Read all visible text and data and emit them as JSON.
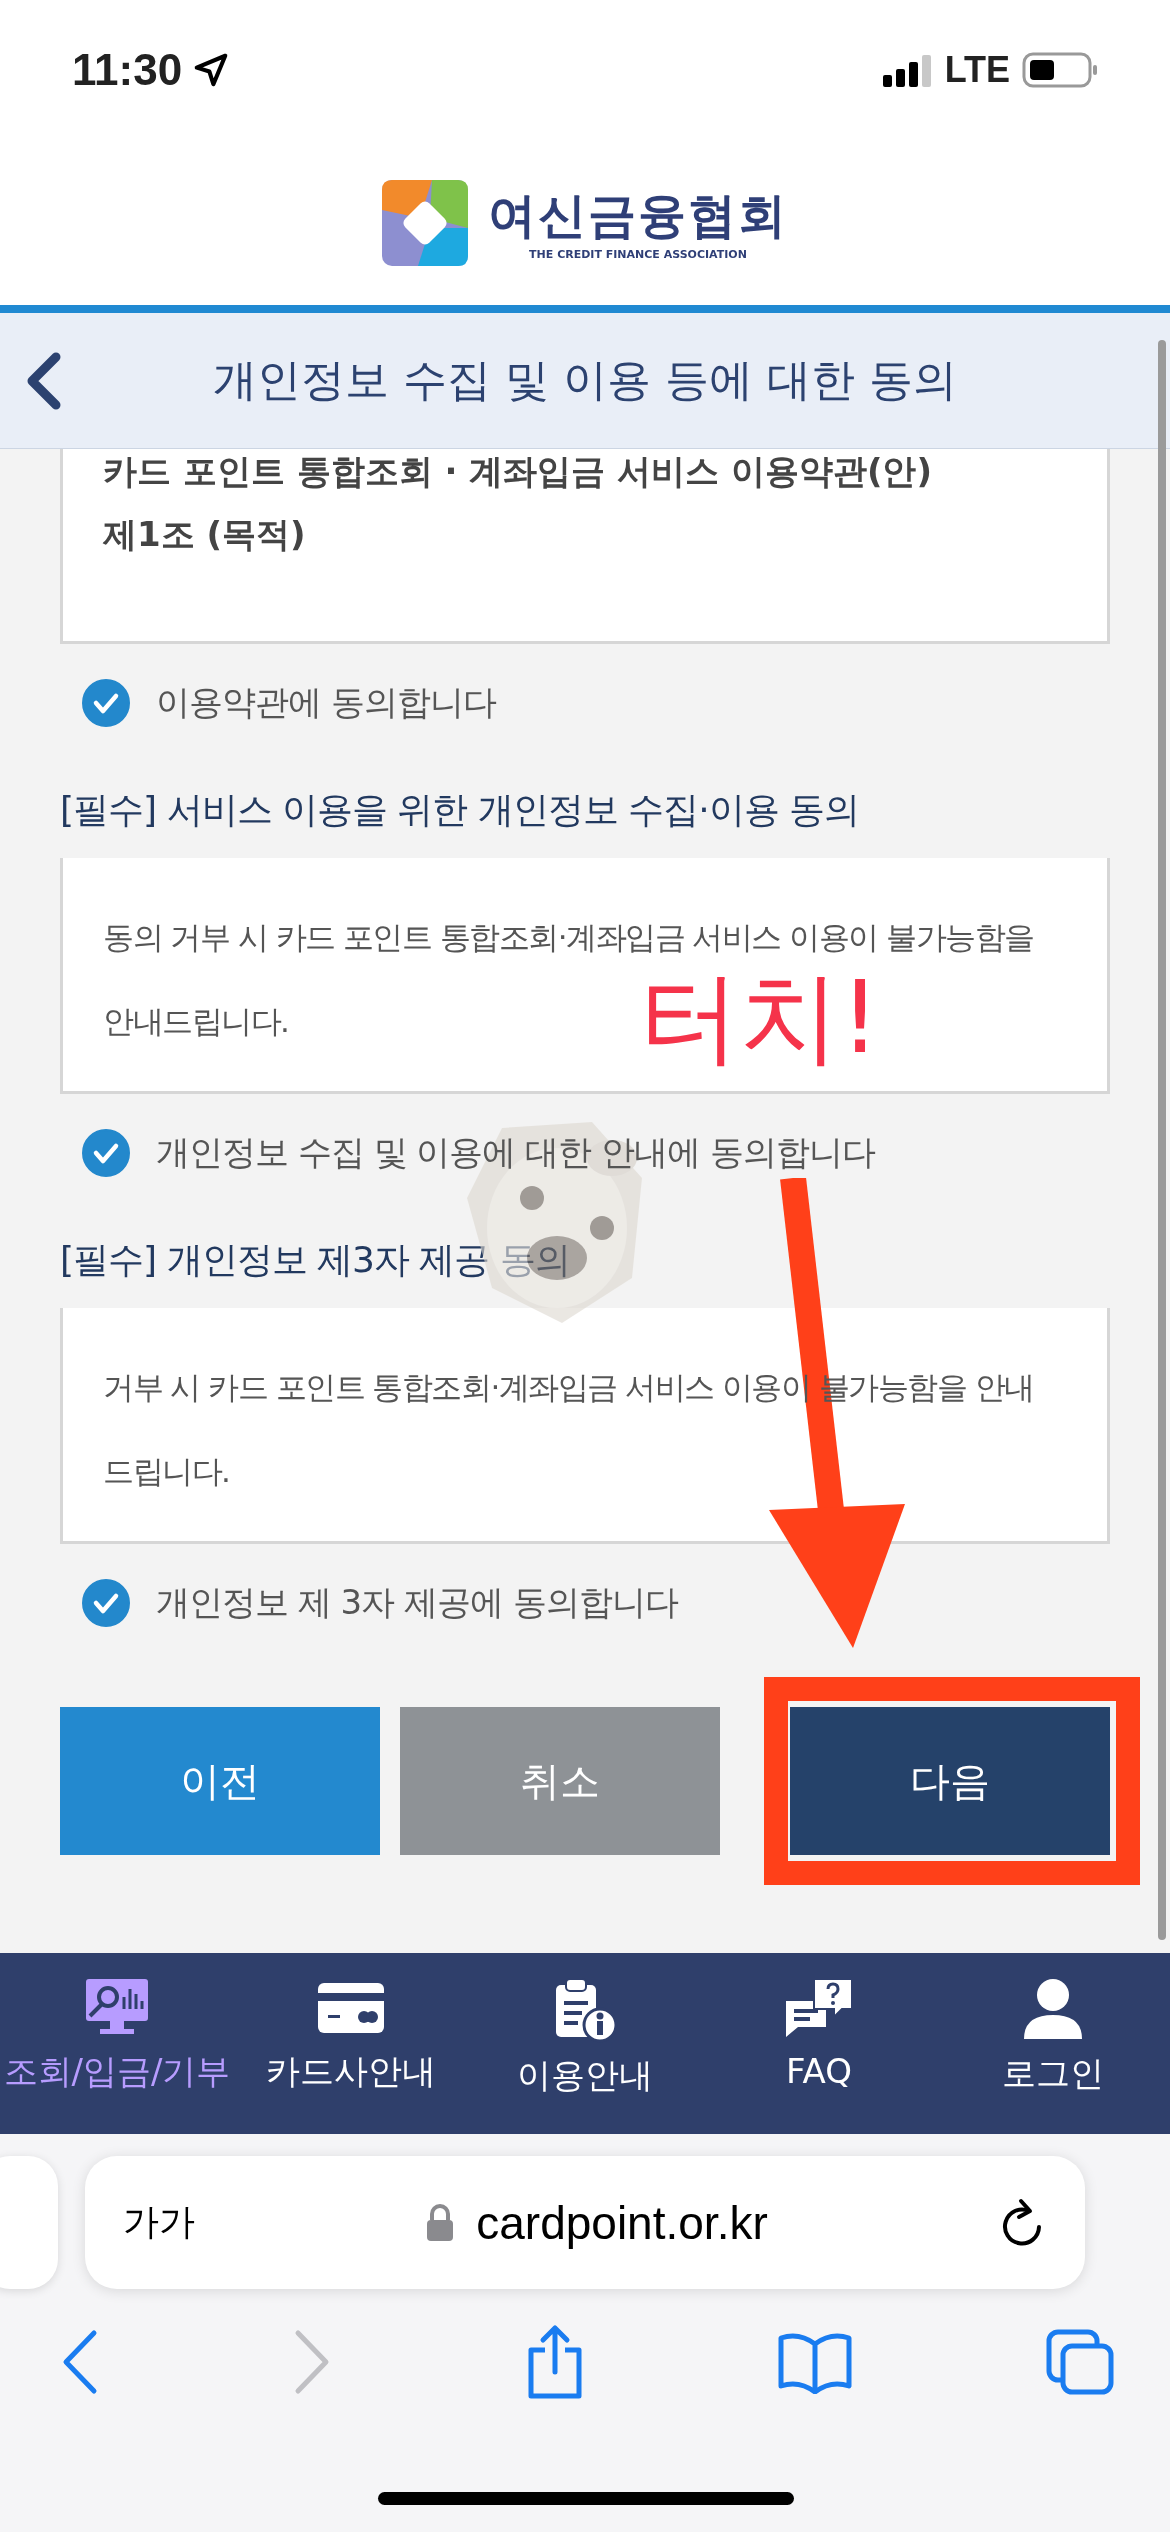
{
  "status_bar": {
    "time": "11:30",
    "network": "LTE"
  },
  "brand": {
    "name": "여신금융협회",
    "subtitle": "THE CREDIT FINANCE ASSOCIATION"
  },
  "page_title": "개인정보 수집 및 이용 등에 대한 동의",
  "sections": [
    {
      "lines": [
        {
          "text": "카드 포인트 통합조회 · 계좌입금 서비스 이용약관(안)",
          "kind": "heading"
        },
        {
          "text": "제1조 (목적)",
          "kind": "heading"
        }
      ],
      "agreement": {
        "label": "이용약관에 동의합니다",
        "checked": true
      }
    },
    {
      "title": "[필수] 서비스 이용을 위한 개인정보 수집·이용 동의",
      "lines": [
        {
          "text": "동의 거부 시 카드 포인트 통합조회·계좌입금 서비스 이용이 불가능함을",
          "kind": "body"
        },
        {
          "text": "안내드립니다.",
          "kind": "body"
        }
      ],
      "agreement": {
        "label": "개인정보 수집 및 이용에 대한 안내에 동의합니다",
        "checked": true
      }
    },
    {
      "title": "[필수] 개인정보 제3자 제공 동의",
      "lines": [
        {
          "text": "거부 시 카드 포인트 통합조회·계좌입금 서비스 이용이 불가능함을 안내",
          "kind": "body"
        },
        {
          "text": "드립니다.",
          "kind": "body"
        }
      ],
      "agreement": {
        "label": "개인정보 제 3자 제공에 동의합니다",
        "checked": true
      }
    }
  ],
  "buttons": [
    {
      "label": "이전",
      "kind": "prev",
      "highlighted": false
    },
    {
      "label": "취소",
      "kind": "cancel",
      "highlighted": false
    },
    {
      "label": "다음",
      "kind": "next",
      "highlighted": true
    }
  ],
  "annotation": {
    "text": "터치!"
  },
  "bottom_nav": [
    {
      "label": "조회/입금/기부",
      "selected": true
    },
    {
      "label": "카드사안내",
      "selected": false
    },
    {
      "label": "이용안내",
      "selected": false
    },
    {
      "label": "FAQ",
      "selected": false
    },
    {
      "label": "로그인",
      "selected": false
    }
  ],
  "browser": {
    "text_size_button": "가가",
    "url": "cardpoint.or.kr"
  }
}
